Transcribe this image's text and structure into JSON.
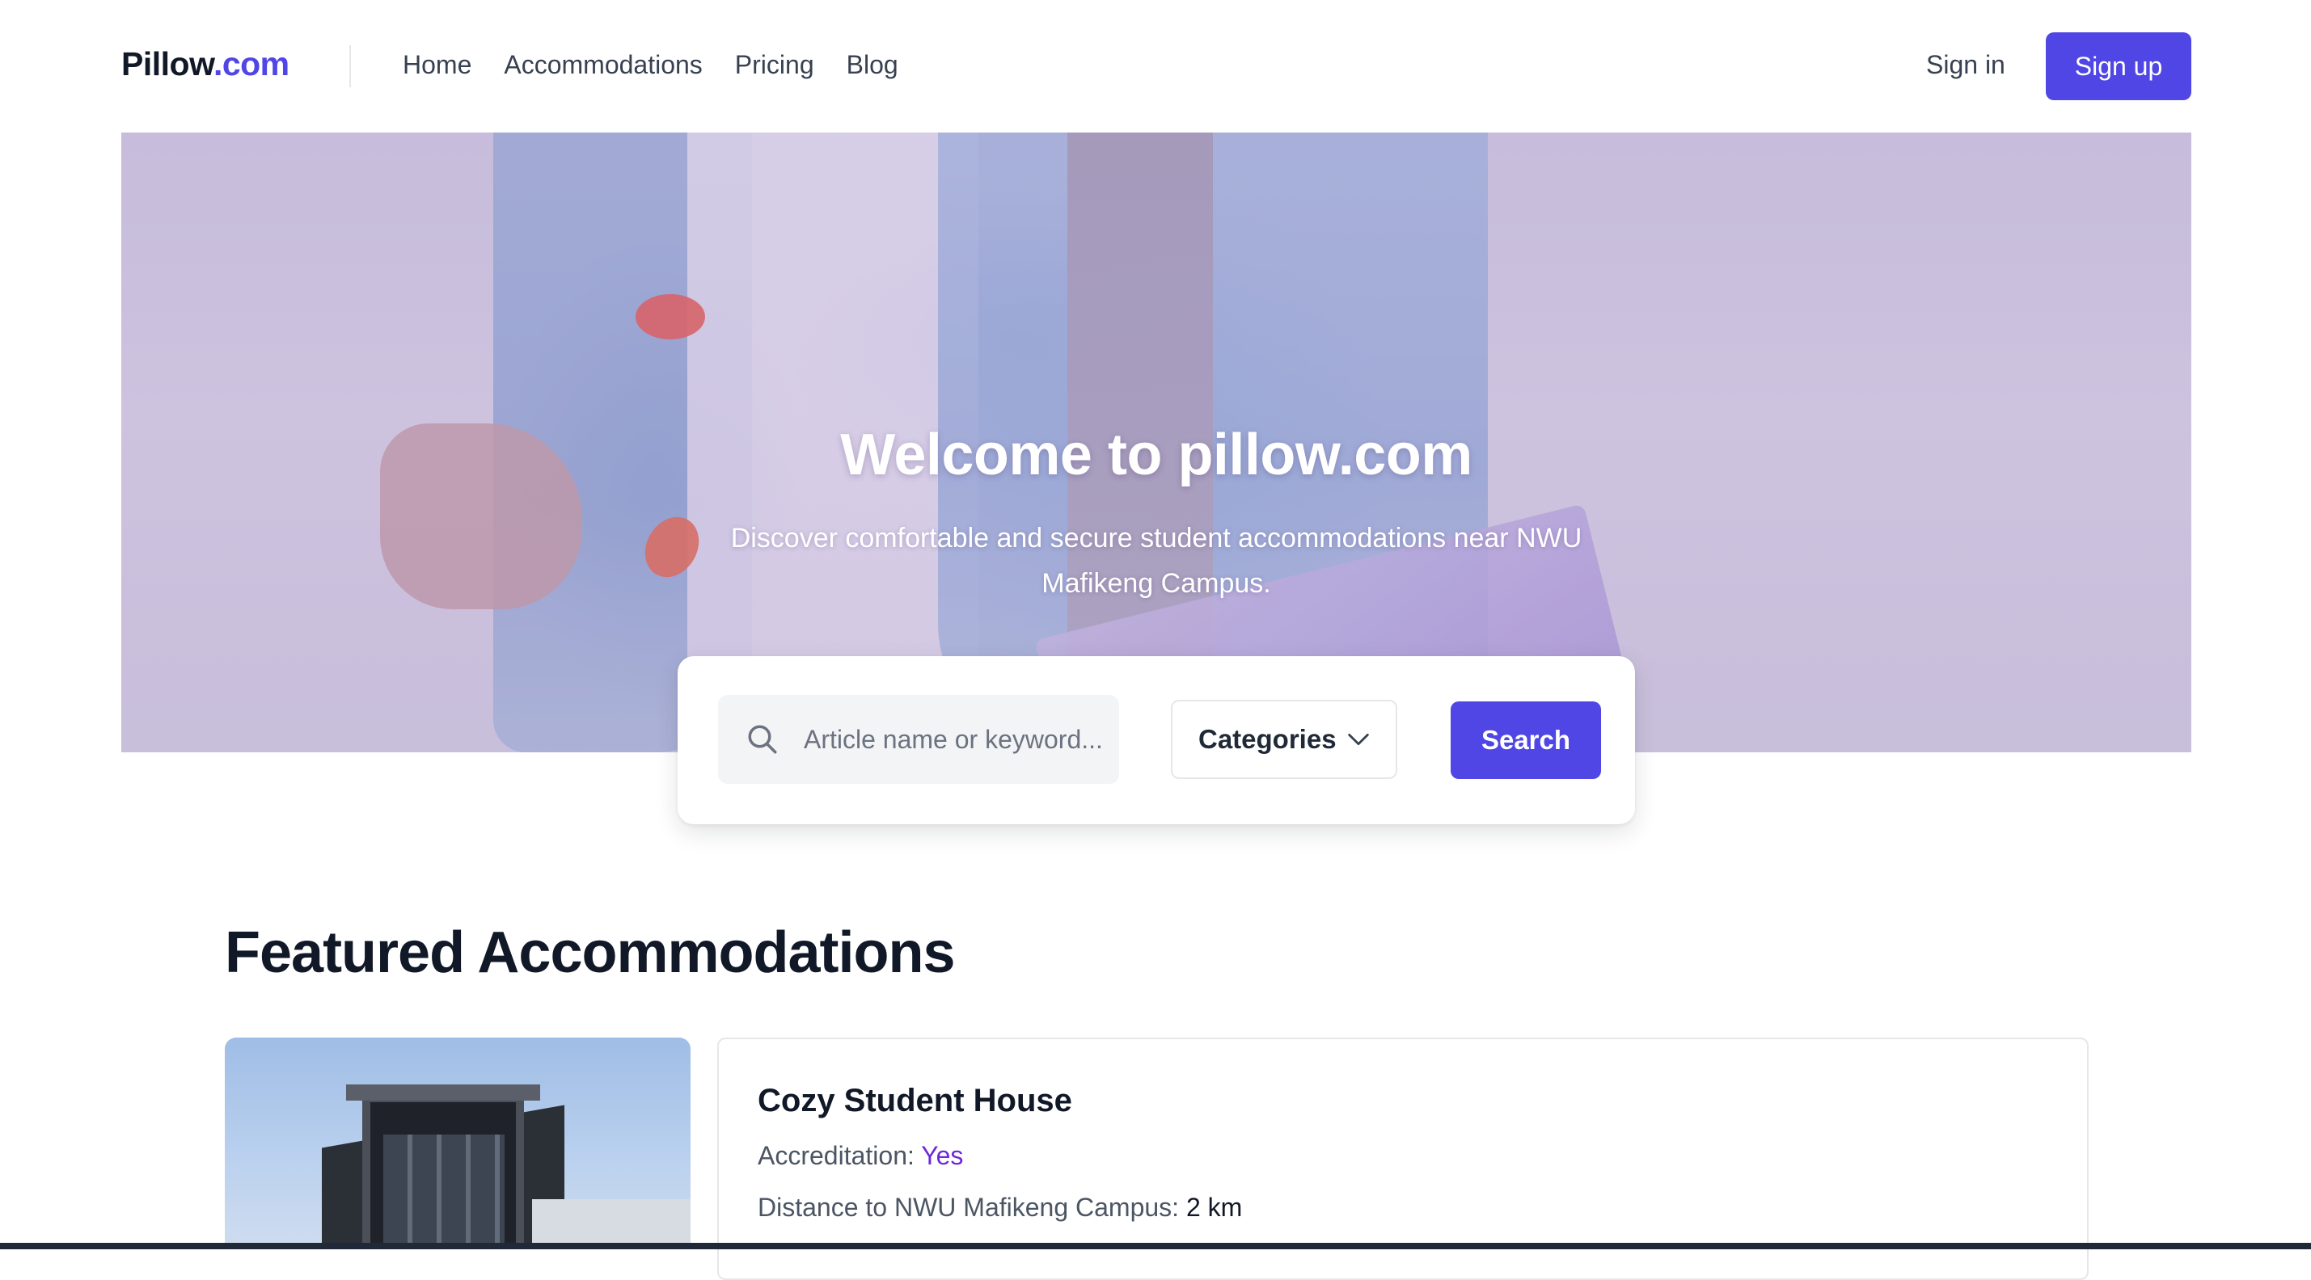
{
  "nav": {
    "logo_main": "Pillow",
    "logo_accent": ".com",
    "links": [
      "Home",
      "Accommodations",
      "Pricing",
      "Blog"
    ],
    "signin_label": "Sign in",
    "signup_label": "Sign up"
  },
  "hero": {
    "title": "Welcome to pillow.com",
    "subtitle": "Discover comfortable and secure student accommodations near NWU Mafikeng Campus."
  },
  "search": {
    "placeholder": "Article name or keyword...",
    "value": "",
    "categories_label": "Categories",
    "button_label": "Search"
  },
  "featured": {
    "title": "Featured Accommodations",
    "cards": [
      {
        "name": "Cozy Student House",
        "accreditation_label": "Accreditation: ",
        "accreditation_value": "Yes",
        "distance_label": "Distance to NWU Mafikeng Campus: ",
        "distance_value": "2 km"
      }
    ]
  },
  "colors": {
    "brand": "#4f46e5",
    "accent_text": "#6d28d9",
    "text_dark": "#111827",
    "text_muted": "#4b5563"
  },
  "icons": [
    "search-icon",
    "chevron-down-icon"
  ]
}
